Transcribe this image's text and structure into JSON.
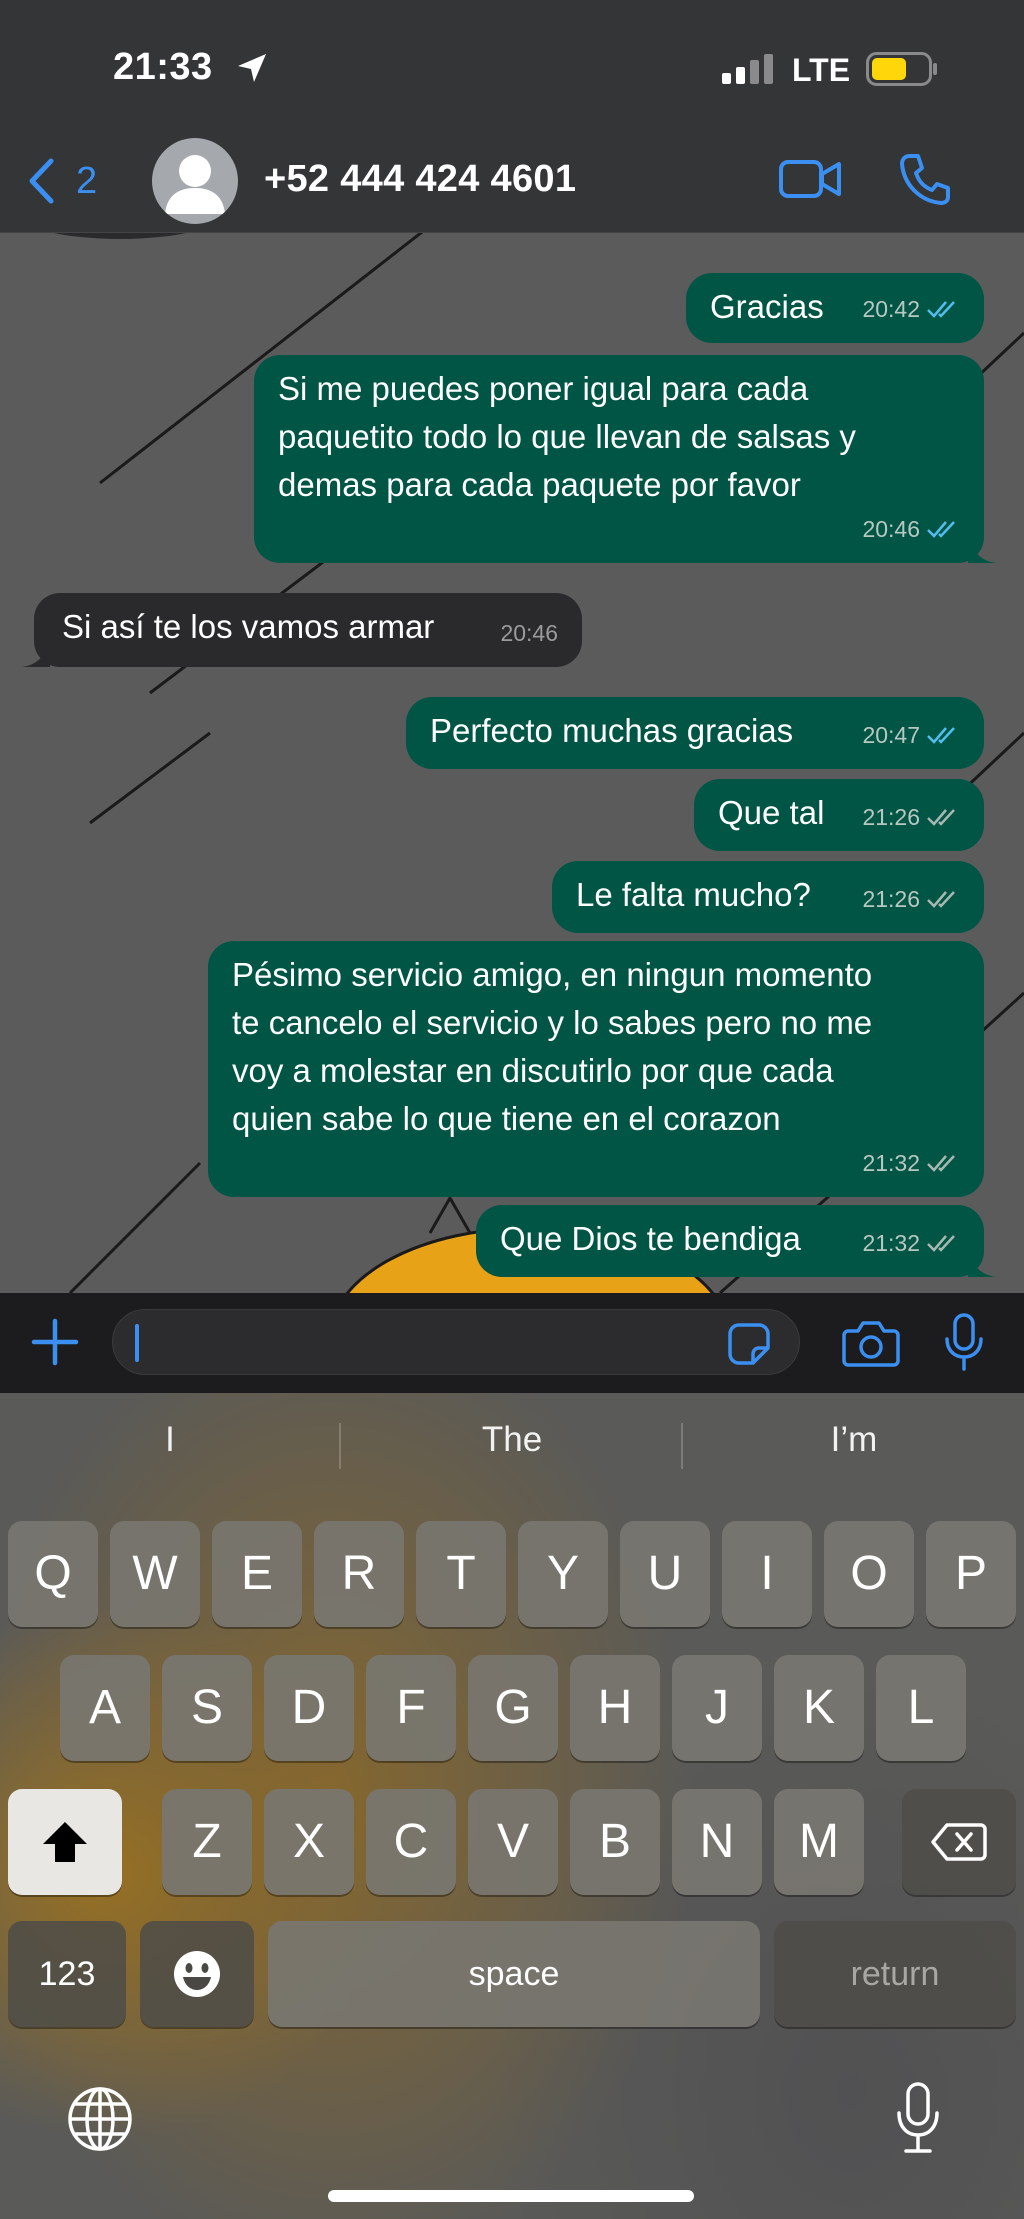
{
  "status_bar": {
    "time": "21:33",
    "network": "LTE",
    "location_icon": "location-arrow-icon",
    "signal_icon": "signal-bars-icon",
    "battery_icon": "battery-low-power-icon"
  },
  "header": {
    "back_count": "2",
    "contact_name": "+52 444 424 4601",
    "icons": [
      "chevron-left-icon",
      "avatar-icon",
      "video-call-icon",
      "phone-call-icon"
    ]
  },
  "messages": [
    {
      "direction": "out",
      "text": "Gracias",
      "time": "20:42",
      "status": "read"
    },
    {
      "direction": "out",
      "lines": [
        "Si me puedes poner igual para cada",
        "paquetito todo lo que llevan de salsas y",
        "demas para cada paquete por favor"
      ],
      "time": "20:46",
      "status": "read"
    },
    {
      "direction": "in",
      "text": "Si así te los vamos armar",
      "time": "20:46"
    },
    {
      "direction": "out",
      "text": "Perfecto muchas gracias",
      "time": "20:47",
      "status": "read"
    },
    {
      "direction": "out",
      "text": "Que tal",
      "time": "21:26",
      "status": "delivered"
    },
    {
      "direction": "out",
      "text": "Le falta mucho?",
      "time": "21:26",
      "status": "delivered"
    },
    {
      "direction": "out",
      "lines": [
        "Pésimo servicio amigo, en ningun momento",
        "te cancelo el servicio y lo sabes pero no me",
        "voy a molestar en discutirlo por que cada",
        "quien sabe lo que tiene en el corazon"
      ],
      "time": "21:32",
      "status": "delivered"
    },
    {
      "direction": "out",
      "text": "Que Dios te bendiga",
      "time": "21:32",
      "status": "delivered"
    }
  ],
  "input_bar": {
    "value": "",
    "icons": [
      "plus-icon",
      "sticker-icon",
      "camera-icon",
      "microphone-icon"
    ]
  },
  "keyboard": {
    "suggestions": [
      "I",
      "The",
      "I’m"
    ],
    "row1": [
      "Q",
      "W",
      "E",
      "R",
      "T",
      "Y",
      "U",
      "I",
      "O",
      "P"
    ],
    "row2": [
      "A",
      "S",
      "D",
      "F",
      "G",
      "H",
      "J",
      "K",
      "L"
    ],
    "row3": [
      "Z",
      "X",
      "C",
      "V",
      "B",
      "N",
      "M"
    ],
    "numbers_label": "123",
    "space_label": "space",
    "return_label": "return",
    "icons": [
      "shift-icon",
      "delete-icon",
      "emoji-icon",
      "globe-icon",
      "dictation-icon"
    ]
  },
  "colors": {
    "outgoing_bubble": "#005545",
    "incoming_bubble": "#2a2a2c",
    "accent": "#3b8ff0",
    "read_ticks": "#53bdeb"
  }
}
